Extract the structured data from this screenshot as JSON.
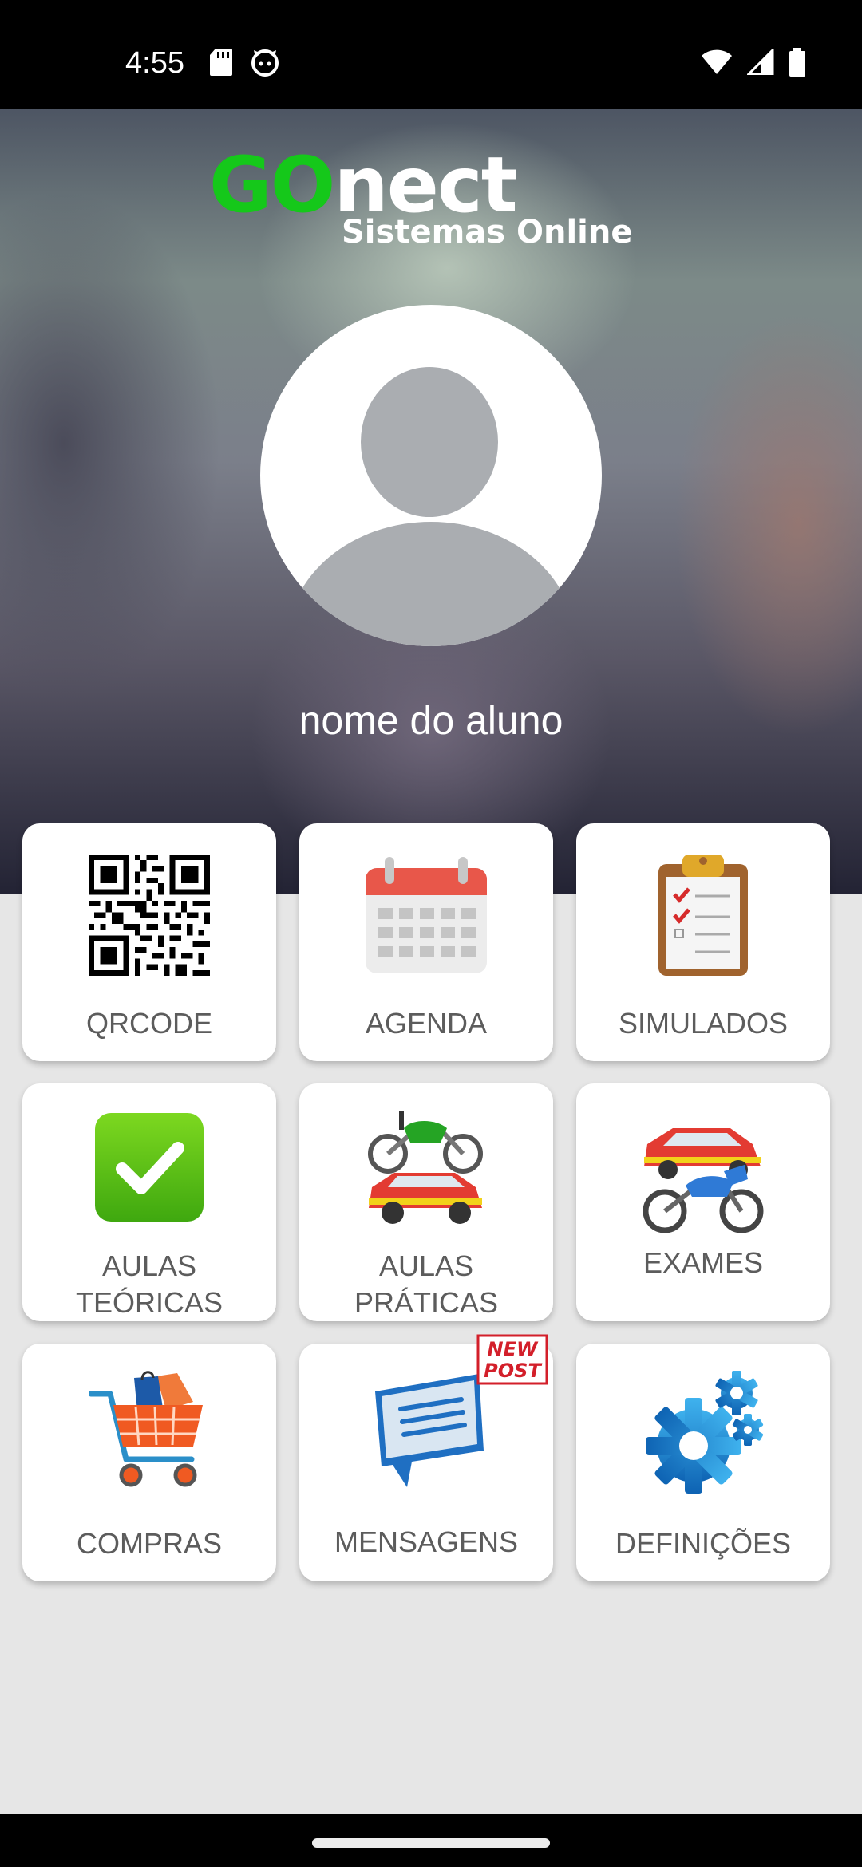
{
  "status_bar": {
    "time": "4:55"
  },
  "logo": {
    "go": "GO",
    "nect": "nect",
    "subtitle": "Sistemas Online"
  },
  "profile": {
    "name": "nome do aluno"
  },
  "tiles": [
    {
      "label": "QRCODE",
      "icon": "qrcode-icon"
    },
    {
      "label": "AGENDA",
      "icon": "calendar-icon"
    },
    {
      "label": "SIMULADOS",
      "icon": "clipboard-checklist-icon"
    },
    {
      "label": "AULAS\nTEÓRICAS",
      "icon": "checkmark-icon"
    },
    {
      "label": "AULAS\nPRÁTICAS",
      "icon": "motorcycle-car-icon"
    },
    {
      "label": "EXAMES",
      "icon": "car-motorcycle-icon"
    },
    {
      "label": "COMPRAS",
      "icon": "shopping-cart-icon"
    },
    {
      "label": "MENSAGENS",
      "icon": "message-icon",
      "badge": {
        "line1": "NEW",
        "line2": "POST"
      }
    },
    {
      "label": "DEFINIÇÕES",
      "icon": "gears-icon"
    }
  ],
  "colors": {
    "brand_green": "#15c81a",
    "tile_text": "#5c5c5c",
    "background": "#e6e6e6"
  }
}
